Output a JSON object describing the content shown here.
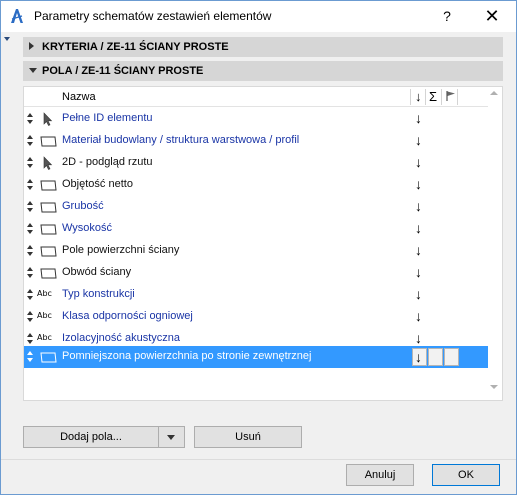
{
  "window": {
    "title": "Parametry schematów zestawień elementów",
    "help_label": "?",
    "close_label": "✕"
  },
  "sections": {
    "criteria": {
      "label": "KRYTERIA / ZE-11 ŚCIANY PROSTE",
      "expanded": false
    },
    "fields": {
      "label": "POLA / ZE-11 ŚCIANY PROSTE",
      "expanded": true
    }
  },
  "list": {
    "column_name": "Nazwa",
    "column_sort_icon": "sort-arrow-icon",
    "column_sum": "Σ",
    "column_flag_icon": "flag-icon",
    "sort_glyph": "↓",
    "rows": [
      {
        "label": "Pełne ID elementu",
        "icon": "cursor-arrow-icon",
        "color": "blue"
      },
      {
        "label": "Materiał budowlany / struktura warstwowa / profil",
        "icon": "element-box-icon",
        "color": "blue"
      },
      {
        "label": "2D - podgląd rzutu",
        "icon": "cursor-arrow-icon",
        "color": "black"
      },
      {
        "label": "Objętość netto",
        "icon": "element-box-icon",
        "color": "black"
      },
      {
        "label": "Grubość",
        "icon": "element-box-icon",
        "color": "blue"
      },
      {
        "label": "Wysokość",
        "icon": "element-box-icon",
        "color": "blue"
      },
      {
        "label": "Pole powierzchni ściany",
        "icon": "element-box-icon",
        "color": "black"
      },
      {
        "label": "Obwód ściany",
        "icon": "element-box-icon",
        "color": "black"
      },
      {
        "label": "Typ konstrukcji",
        "icon": "abc-text-icon",
        "icon_text": "Abc",
        "color": "blue"
      },
      {
        "label": "Klasa odporności ogniowej",
        "icon": "abc-text-icon",
        "icon_text": "Abc",
        "color": "blue"
      },
      {
        "label": "Izolacyjność akustyczna",
        "icon": "abc-text-icon",
        "icon_text": "Abc",
        "color": "blue"
      },
      {
        "label": "Pomniejszona powierzchnia po stronie zewnętrznej",
        "icon": "element-box-icon",
        "color": "white",
        "selected": true
      }
    ]
  },
  "buttons": {
    "add_field": "Dodaj pola...",
    "remove": "Usuń",
    "cancel": "Anuluj",
    "ok": "OK"
  },
  "colors": {
    "selection": "#3399ff",
    "blue_text": "#1a35a6",
    "section_header_bg": "#d6d6d6",
    "window_border": "#6b9bd1"
  }
}
